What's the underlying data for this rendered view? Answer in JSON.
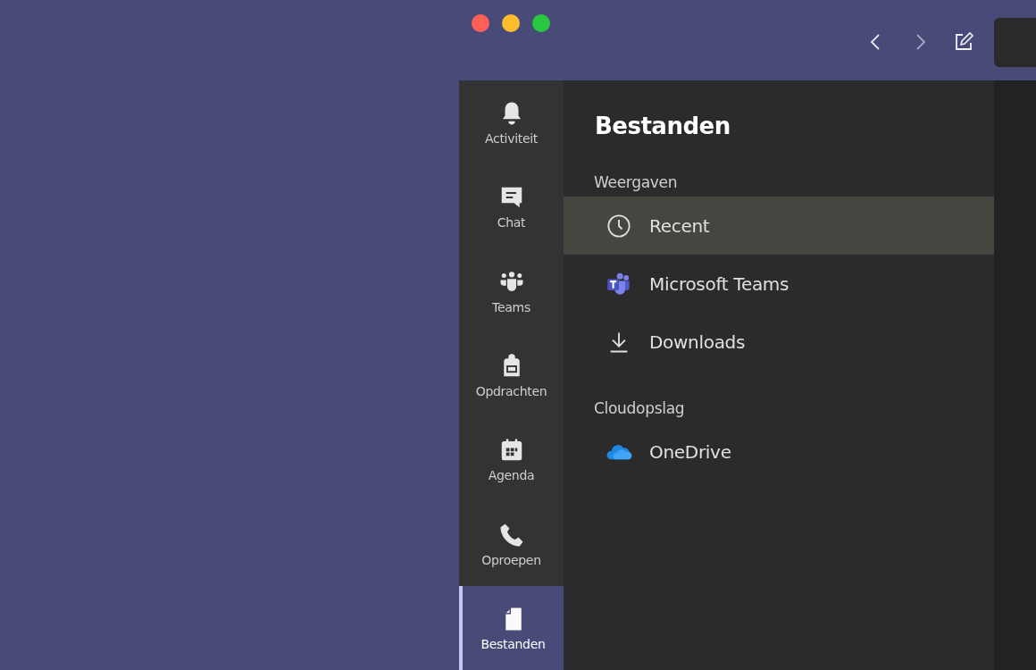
{
  "rail": [
    {
      "label": "Activiteit",
      "kind": "bell",
      "selected": false
    },
    {
      "label": "Chat",
      "kind": "chat",
      "selected": false
    },
    {
      "label": "Teams",
      "kind": "teams",
      "selected": false
    },
    {
      "label": "Opdrachten",
      "kind": "bag",
      "selected": false
    },
    {
      "label": "Agenda",
      "kind": "calendar",
      "selected": false
    },
    {
      "label": "Oproepen",
      "kind": "phone",
      "selected": false
    },
    {
      "label": "Bestanden",
      "kind": "file",
      "selected": true
    }
  ],
  "panel": {
    "title": "Bestanden",
    "sections": [
      {
        "heading": "Weergaven",
        "items": [
          {
            "label": "Recent",
            "kind": "clock",
            "selected": true
          },
          {
            "label": "Microsoft Teams",
            "kind": "teamslogo",
            "selected": false
          },
          {
            "label": "Downloads",
            "kind": "download",
            "selected": false
          }
        ]
      },
      {
        "heading": "Cloudopslag",
        "items": [
          {
            "label": "OneDrive",
            "kind": "cloud",
            "selected": false
          }
        ]
      }
    ]
  }
}
